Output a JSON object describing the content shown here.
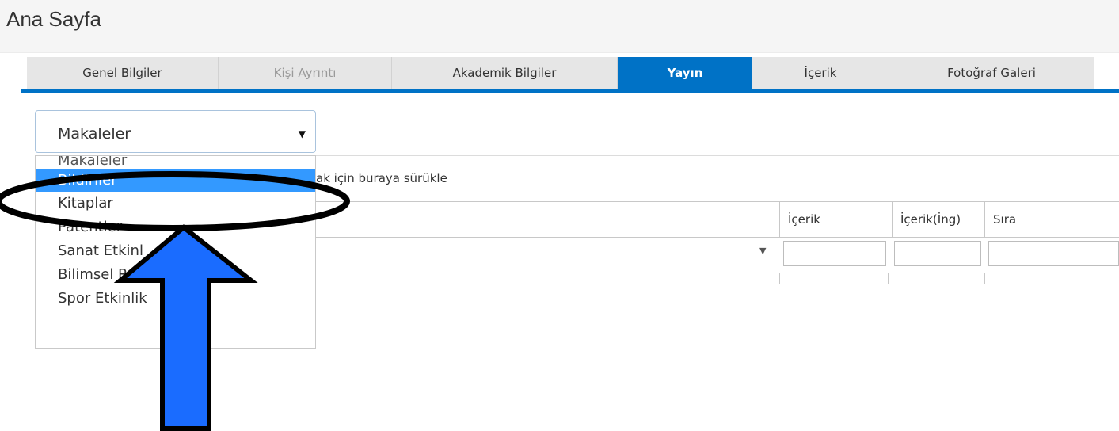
{
  "page": {
    "title": "Ana Sayfa"
  },
  "tabs": [
    {
      "label": "Genel Bilgiler",
      "state": "normal"
    },
    {
      "label": "Kişi Ayrıntı",
      "state": "disabled"
    },
    {
      "label": "Akademik Bilgiler",
      "state": "normal"
    },
    {
      "label": "Yayın",
      "state": "active"
    },
    {
      "label": "İçerik",
      "state": "normal"
    },
    {
      "label": "Fotoğraf Galeri",
      "state": "normal"
    }
  ],
  "publication_select": {
    "value": "Makaleler",
    "caret_icon": "caret-down-icon",
    "options": [
      "Makaleler",
      "Bildiriler",
      "Kitaplar",
      "Patentler",
      "Sanat Etkinl",
      "Bilimsel Rap",
      "Spor Etkinlik"
    ],
    "highlighted_index": 1
  },
  "grid": {
    "group_hint": "ak için buraya sürükle",
    "columns": [
      "İçerik",
      "İçerik(İng)",
      "Sıra"
    ]
  },
  "annotation": {
    "ring_color": "#000000",
    "arrow_fill": "#1a6cff",
    "arrow_stroke": "#000000"
  },
  "colors": {
    "accent": "#0072c6",
    "highlight": "#3399ff"
  }
}
